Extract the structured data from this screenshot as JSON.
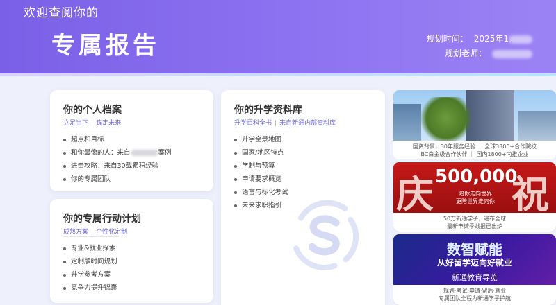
{
  "header": {
    "welcome": "欢迎查阅你的",
    "title": "专属报告",
    "plan_time_label": "规划时间：",
    "plan_time_value": "2025年1",
    "planner_label": "规划老师："
  },
  "cards": {
    "profile": {
      "title": "你的个人档案",
      "sub_a": "立足当下",
      "sub_b": "锚定未来",
      "items": [
        "起点和目标",
        "和你最像的人：来自",
        "案例",
        "进击攻略：来自30载累积经验",
        "你的专属团队"
      ]
    },
    "library": {
      "title": "你的升学资料库",
      "sub_a": "升学百科全书",
      "sub_b": "来自新通内部资料库",
      "items": [
        "升学全景地图",
        "国家/地区特点",
        "学制与预算",
        "申请要求概览",
        "语言与标化考试",
        "未来求职指引"
      ]
    },
    "action": {
      "title": "你的专属行动计划",
      "sub_a": "成熟方案",
      "sub_b": "个性化定制",
      "items": [
        "专业&就业探索",
        "定制版时间规划",
        "升学参考方案",
        "竞争力提升锦囊"
      ]
    }
  },
  "images": {
    "img1": {
      "caption1": "国资背景，30年服务经验 ｜ 全球3300+合作院校",
      "caption2": "BC白金级合作伙伴 ｜ 国内1800+内推企业"
    },
    "img2": {
      "char1": "庆",
      "char2": "祝",
      "number": "500,000",
      "slogan1": "陪你走向世界",
      "slogan2": "更陪世界走向你",
      "caption1": "50万新通学子，遍布全球",
      "caption2": "最新申请季战报已出炉"
    },
    "img3": {
      "title": "数智赋能",
      "subtitle": "从好留学迈向好就业",
      "tag": "新通教育导览",
      "caption1": "规划·考试·申请·留后·就业",
      "caption2": "专属团队全程为新通学子护航"
    }
  },
  "colors": {
    "banner": "#7a60e6",
    "accent": "#6a67d8",
    "card": "#ffffff",
    "bg": "#eef0fb"
  }
}
